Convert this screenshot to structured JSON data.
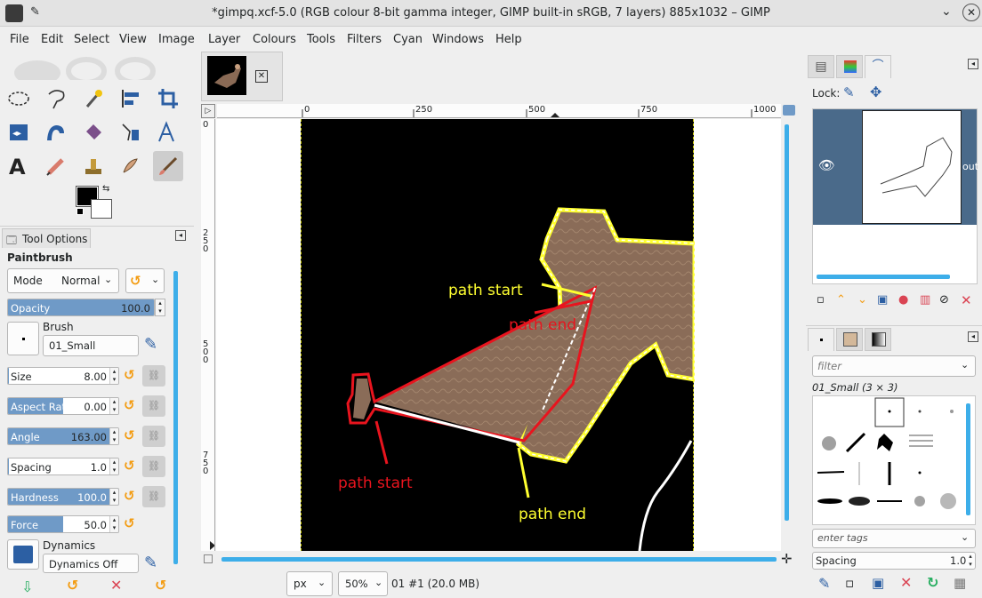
{
  "window": {
    "title": "*gimpq.xcf-5.0 (RGB colour 8-bit gamma integer, GIMP built-in sRGB, 7 layers) 885x1032 – GIMP"
  },
  "menu": [
    "File",
    "Edit",
    "Select",
    "View",
    "Image",
    "Layer",
    "Colours",
    "Tools",
    "Filters",
    "Cyan",
    "Windows",
    "Help"
  ],
  "tool_options": {
    "tab_label": "Tool Options",
    "tool_name": "Paintbrush",
    "mode_label": "Mode",
    "mode_value": "Normal",
    "opacity": {
      "label": "Opacity",
      "value": "100.0",
      "fraction": 1.0
    },
    "brush_label": "Brush",
    "brush_name": "01_Small",
    "size": {
      "label": "Size",
      "value": "8.00",
      "fraction": 0.01
    },
    "aspect": {
      "label": "Aspect Ratio",
      "value": "0.00",
      "fraction": 0.5
    },
    "angle": {
      "label": "Angle",
      "value": "163.00",
      "fraction": 0.95
    },
    "spacing": {
      "label": "Spacing",
      "value": "1.0",
      "fraction": 0.01
    },
    "hardness": {
      "label": "Hardness",
      "value": "100.0",
      "fraction": 1.0
    },
    "force": {
      "label": "Force",
      "value": "50.0",
      "fraction": 0.5
    },
    "dynamics_label": "Dynamics",
    "dynamics_name": "Dynamics Off"
  },
  "ruler": {
    "h_ticks": [
      "0",
      "250",
      "500",
      "750",
      "1000"
    ],
    "v_ticks": [
      "0",
      "250",
      "500",
      "750"
    ]
  },
  "annotations": {
    "yellow_start": "path start",
    "red_end": "path end",
    "red_start": "path start",
    "yellow_end": "path end"
  },
  "statusbar": {
    "unit": "px",
    "zoom": "50%",
    "info": "01 #1 (20.0 MB)"
  },
  "layers": {
    "lock_label": "Lock:",
    "layer_name": "out"
  },
  "brushes": {
    "filter_placeholder": "filter",
    "brush_caption": "01_Small (3 × 3)",
    "tags_placeholder": "enter tags",
    "spacing_label": "Spacing",
    "spacing_value": "1.0"
  },
  "colors": {
    "accent": "#6f9ac7",
    "yellow": "#ffff30",
    "red": "#e8141e",
    "layer_bg": "#4a6a8a"
  }
}
